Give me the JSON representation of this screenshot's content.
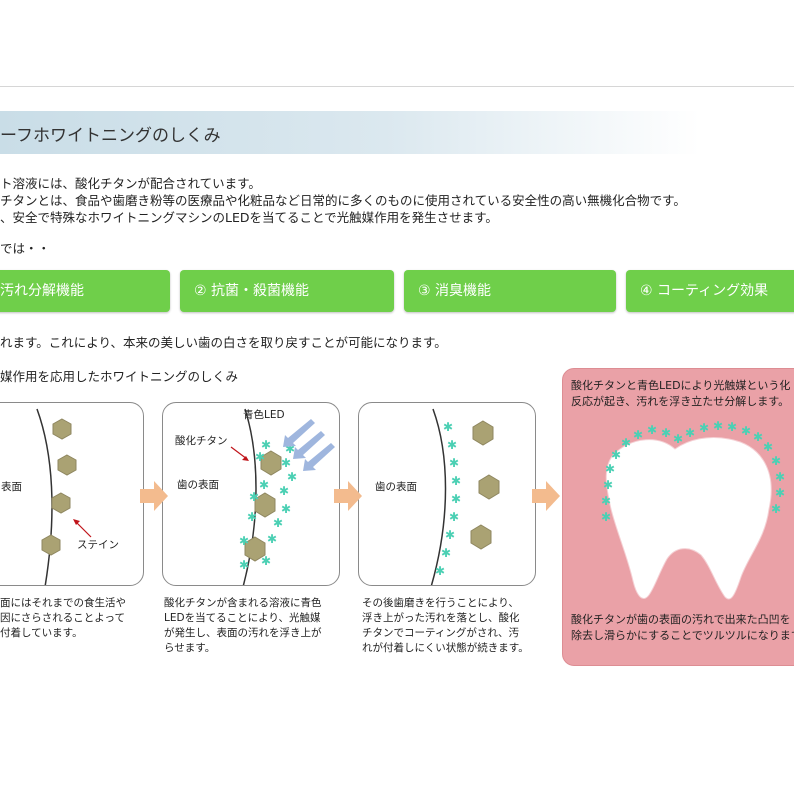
{
  "title": "ーフホワイトニングのしくみ",
  "intro_lines": [
    "ト溶液には、酸化チタンが配合されています。",
    "チタンとは、食品や歯磨き粉等の医療品や化粧品など日常的に多くのものに使用されている安全性の高い無機化合物です。",
    "、安全で特殊なホワイトニングマシンのLEDを当てることで光触媒作用を発生させます。"
  ],
  "lead": "では・・",
  "functions": [
    "汚れ分解機能",
    "② 抗菌・殺菌機能",
    "③ 消臭機能",
    "④ コーティング効果"
  ],
  "result": "れます。これにより、本来の美しい歯の白さを取り戻すことが可能になります。",
  "subheading": "媒作用を応用したホワイトニングのしくみ",
  "panels": {
    "p1": {
      "tooth_surface": "表面",
      "stain": "ステイン",
      "caption": [
        "面にはそれまでの食生活や",
        "因にさらされることよって",
        "付着しています。"
      ]
    },
    "p2": {
      "blue_led": "青色LED",
      "titanium": "酸化チタン",
      "tooth_surface": "歯の表面",
      "caption": [
        "酸化チタンが含まれる溶液に青色",
        "LEDを当てることにより、光触媒",
        "が発生し、表面の汚れを浮き上が",
        "らせます。"
      ]
    },
    "p3": {
      "tooth_surface": "歯の表面",
      "caption": [
        "その後歯磨きを行うことにより、",
        "浮き上がった汚れを落とし、酸化",
        "チタンでコーティングがされ、汚",
        "れが付着しにくい状態が続きます。"
      ]
    }
  },
  "final": {
    "top": [
      "酸化チタンと青色LEDにより光触媒という化",
      "反応が起き、汚れを浮き立たせ分解します。"
    ],
    "bottom": [
      "酸化チタンが歯の表面の汚れで出来た凸凹を",
      "除去し滑らかにすることでツルツルになります"
    ]
  },
  "colors": {
    "green": "#6fcf4a",
    "stain": "#aaa273",
    "sparkle": "#4cd0b4",
    "led_arrow": "#9fb6de",
    "flow_arrow": "#f3bb8e",
    "pink": "#eaa1a7"
  }
}
